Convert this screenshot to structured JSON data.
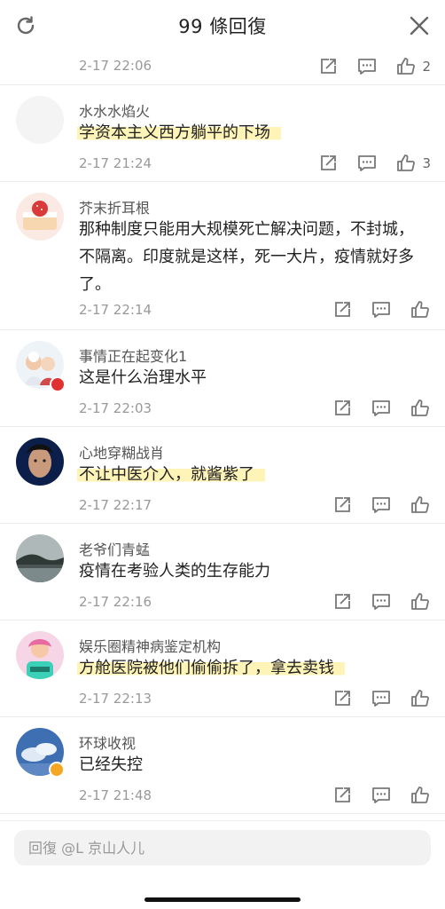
{
  "header": {
    "title": "99 條回復"
  },
  "top_partial": {
    "time": "2-17 22:06",
    "like_count": "2"
  },
  "comments": [
    {
      "name": "水水水焰火",
      "text": "学资本主义西方躺平的下场",
      "time": "2-17 21:24",
      "like_count": "3",
      "highlight": true
    },
    {
      "name": "芥末折耳根",
      "text": "那种制度只能用大规模死亡解决问题，不封城，不隔离。印度就是这样，死一大片，疫情就好多了。",
      "time": "2-17 22:14",
      "like_count": "",
      "highlight": false
    },
    {
      "name": "事情正在起变化1",
      "text": "这是什么治理水平",
      "time": "2-17 22:03",
      "like_count": "",
      "highlight": false
    },
    {
      "name": "心地穿糊战肖",
      "text": "不让中医介入，就酱紫了",
      "time": "2-17 22:17",
      "like_count": "",
      "highlight": true
    },
    {
      "name": "老爷们青蜢",
      "text": "疫情在考验人类的生存能力",
      "time": "2-17 22:16",
      "like_count": "",
      "highlight": false
    },
    {
      "name": "娱乐圈精神病鉴定机构",
      "text": "方舱医院被他们偷偷拆了，拿去卖钱",
      "time": "2-17 22:13",
      "like_count": "",
      "highlight": true
    },
    {
      "name": "环球收视",
      "text": "已经失控",
      "time": "2-17 21:48",
      "like_count": "",
      "highlight": false
    }
  ],
  "reply": {
    "placeholder": "回復 @L 京山人儿"
  },
  "icons": [
    "refresh-icon",
    "close-icon",
    "share-icon",
    "comment-icon",
    "like-icon"
  ],
  "colors": {
    "highlight": "#fff4b8",
    "text": "#222222",
    "secondary": "#999999",
    "divider": "#ececec"
  }
}
